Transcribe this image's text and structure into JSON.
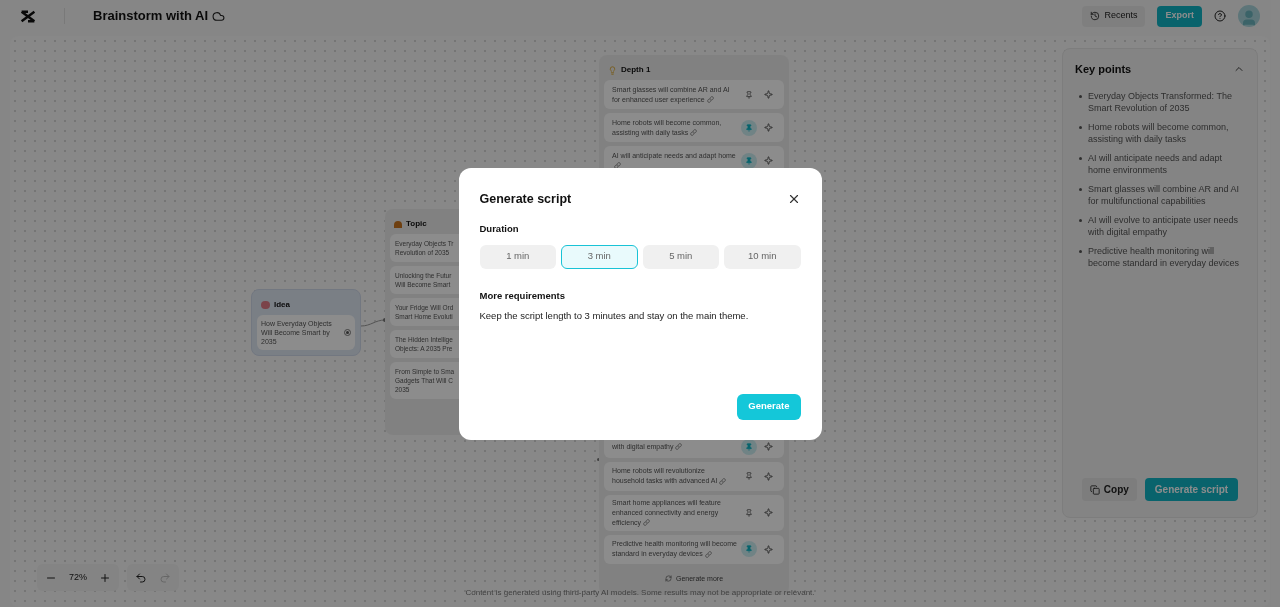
{
  "header": {
    "title": "Brainstorm with AI",
    "recents": "Recents",
    "export": "Export"
  },
  "idea": {
    "title": "Idea",
    "text": "How Everyday Objects Will Become Smart by 2035"
  },
  "topic": {
    "title": "Topic",
    "items": [
      {
        "lines": [
          "Everyday Objects Tr",
          "Revolution of 2035"
        ]
      },
      {
        "lines": [
          "Unlocking the Futur",
          "Will Become Smart"
        ]
      },
      {
        "lines": [
          "Your Fridge Will Ord",
          "Smart Home Evoluti"
        ]
      },
      {
        "lines": [
          "The Hidden Intellige",
          "Objects: A 2035 Pre"
        ]
      },
      {
        "lines": [
          "From Simple to Sma",
          "Gadgets That Will C",
          "2035"
        ]
      }
    ]
  },
  "depth": {
    "title": "Depth 1",
    "top_items": [
      {
        "text": "Smart glasses will combine AR and AI for enhanced user experience",
        "pinned": false
      },
      {
        "text": "Home robots will become common, assisting with daily tasks",
        "pinned": true
      },
      {
        "text": "AI will anticipate needs and adapt home",
        "pinned": true
      }
    ],
    "bottom_items": [
      {
        "text": "with digital empathy",
        "pinned": true
      },
      {
        "text": "Home robots will revolutionize household tasks with advanced AI",
        "pinned": false
      },
      {
        "text": "Smart home appliances will feature enhanced connectivity and energy efficiency",
        "pinned": false
      },
      {
        "text": "Predictive health monitoring will become standard in everyday devices",
        "pinned": true
      }
    ],
    "more": "Generate more"
  },
  "key_points": {
    "title": "Key points",
    "expanded": true,
    "items": [
      "Everyday Objects Transformed: The Smart Revolution of 2035",
      "Home robots will become common, assisting with daily tasks",
      "AI will anticipate needs and adapt home environments",
      "Smart glasses will combine AR and AI for multifunctional capabilities",
      "AI will evolve to anticipate user needs with digital empathy",
      "Predictive health monitoring will become standard in everyday devices"
    ],
    "copy": "Copy",
    "generate": "Generate script"
  },
  "zoom": {
    "value": "72%"
  },
  "disclaimer": "Content is generated using third-party AI models. Some results may not be appropriate or relevant.",
  "modal": {
    "title": "Generate script",
    "duration_label": "Duration",
    "options": [
      {
        "label": "1 min",
        "selected": false
      },
      {
        "label": "3 min",
        "selected": true
      },
      {
        "label": "5 min",
        "selected": false
      },
      {
        "label": "10 min",
        "selected": false
      }
    ],
    "requirements_label": "More requirements",
    "requirements": "Keep the script length to 3 minutes and stay on the main theme.",
    "generate": "Generate"
  }
}
